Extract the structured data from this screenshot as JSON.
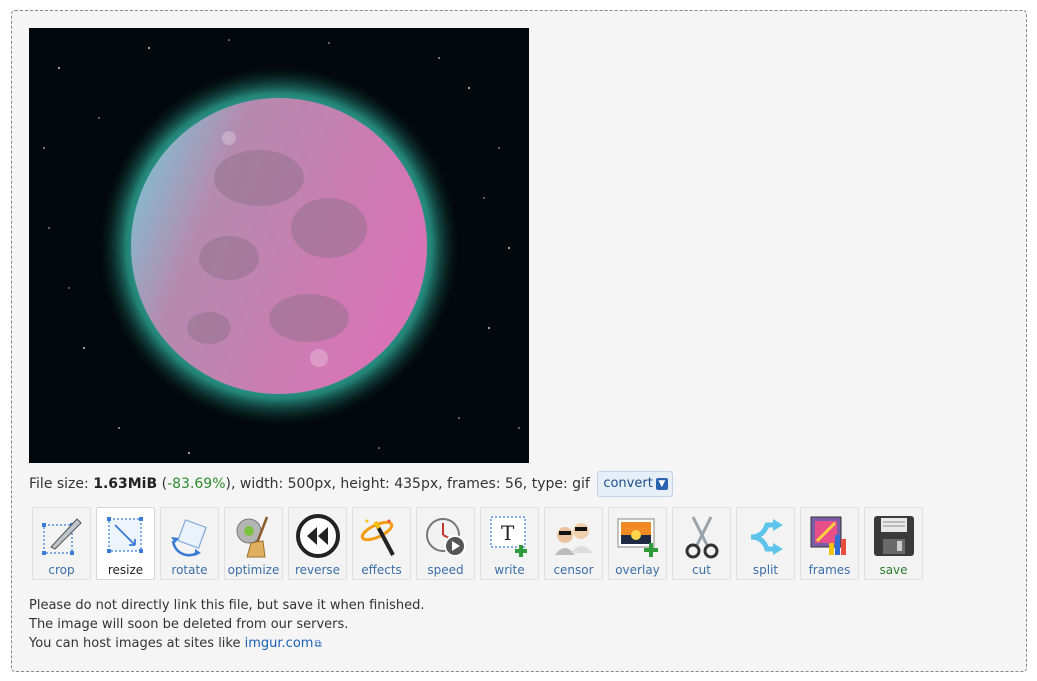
{
  "file_info": {
    "size_label": "File size: ",
    "size": "1.63MiB",
    "open_paren": " (",
    "reduction": "-83.69%",
    "rest": "), width: 500px, height: 435px, frames: 56, type: gif",
    "convert_label": "convert"
  },
  "tools": [
    {
      "label": "crop",
      "icon": "crop-icon"
    },
    {
      "label": "resize",
      "icon": "resize-icon"
    },
    {
      "label": "rotate",
      "icon": "rotate-icon"
    },
    {
      "label": "optimize",
      "icon": "optimize-icon"
    },
    {
      "label": "reverse",
      "icon": "reverse-icon"
    },
    {
      "label": "effects",
      "icon": "effects-icon"
    },
    {
      "label": "speed",
      "icon": "speed-icon"
    },
    {
      "label": "write",
      "icon": "write-icon"
    },
    {
      "label": "censor",
      "icon": "censor-icon"
    },
    {
      "label": "overlay",
      "icon": "overlay-icon"
    },
    {
      "label": "cut",
      "icon": "cut-icon"
    },
    {
      "label": "split",
      "icon": "split-icon"
    },
    {
      "label": "frames",
      "icon": "frames-icon"
    },
    {
      "label": "save",
      "icon": "save-icon"
    }
  ],
  "notes": {
    "line1": "Please do not directly link this file, but save it when finished.",
    "line2": "The image will soon be deleted from our servers.",
    "line3_prefix": "You can host images at sites like ",
    "link": "imgur.com"
  },
  "colors": {
    "panel_bg": "#f5f5f5",
    "link": "#1a5fb4",
    "positive": "#2e8b2e"
  }
}
